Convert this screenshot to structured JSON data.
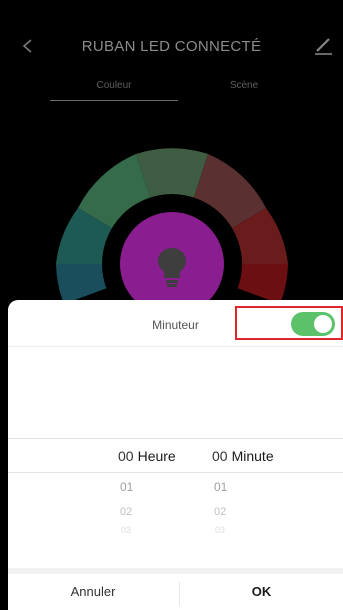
{
  "header": {
    "title": "RUBAN LED CONNECTÉ",
    "tabs": [
      {
        "label": "Couleur"
      },
      {
        "label": "Scène"
      }
    ]
  },
  "timer": {
    "title": "Minuteur",
    "toggle_on": true,
    "picker": {
      "hour": {
        "selected": "00",
        "unit": "Heure",
        "below": [
          "01",
          "02",
          "03"
        ]
      },
      "minute": {
        "selected": "00",
        "unit": "Minute",
        "below": [
          "01",
          "02",
          "03"
        ]
      }
    }
  },
  "footer": {
    "cancel_label": "Annuler",
    "ok_label": "OK"
  },
  "colors": {
    "toggle_on": "#5cc26a",
    "highlight": "#e0262b",
    "center_purple": "#8a1d8f"
  }
}
